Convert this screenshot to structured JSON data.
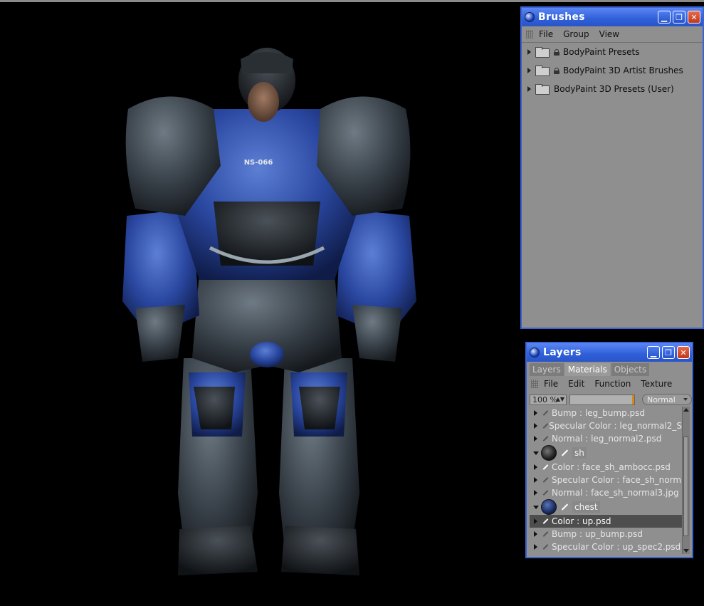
{
  "viewport": {
    "hull_label": "NS-066"
  },
  "brushes": {
    "title": "Brushes",
    "menu": [
      "File",
      "Group",
      "View"
    ],
    "items": [
      {
        "label": "BodyPaint Presets",
        "locked": true
      },
      {
        "label": "BodyPaint 3D Artist Brushes",
        "locked": true
      },
      {
        "label": "BodyPaint 3D Presets (User)",
        "locked": false
      }
    ]
  },
  "layers": {
    "title": "Layers",
    "tabs": [
      "Layers",
      "Materials",
      "Objects"
    ],
    "active_tab": "Materials",
    "menu": [
      "File",
      "Edit",
      "Function",
      "Texture"
    ],
    "zoom": "100 %",
    "blend_mode": "Normal",
    "rows": [
      {
        "kind": "channel",
        "label": "Bump : leg_bump.psd"
      },
      {
        "kind": "channel",
        "label": "Specular Color : leg_normal2_S"
      },
      {
        "kind": "channel",
        "label": "Normal : leg_normal2.psd"
      },
      {
        "kind": "material",
        "label": "sh"
      },
      {
        "kind": "channel",
        "label": "Color : face_sh_ambocc.psd"
      },
      {
        "kind": "channel",
        "label": "Specular Color : face_sh_norm"
      },
      {
        "kind": "channel",
        "label": "Normal : face_sh_normal3.jpg"
      },
      {
        "kind": "material",
        "label": "chest"
      },
      {
        "kind": "channel",
        "label": "Color : up.psd",
        "selected": true
      },
      {
        "kind": "channel",
        "label": "Bump : up_bump.psd"
      },
      {
        "kind": "channel",
        "label": "Specular Color : up_spec2.psd"
      }
    ]
  },
  "colors": {
    "titlebar": "#2f5fd8",
    "panel_bg": "#8f8f8f",
    "armor_blue": "#2c4ea8",
    "armor_gray": "#3c444c"
  }
}
